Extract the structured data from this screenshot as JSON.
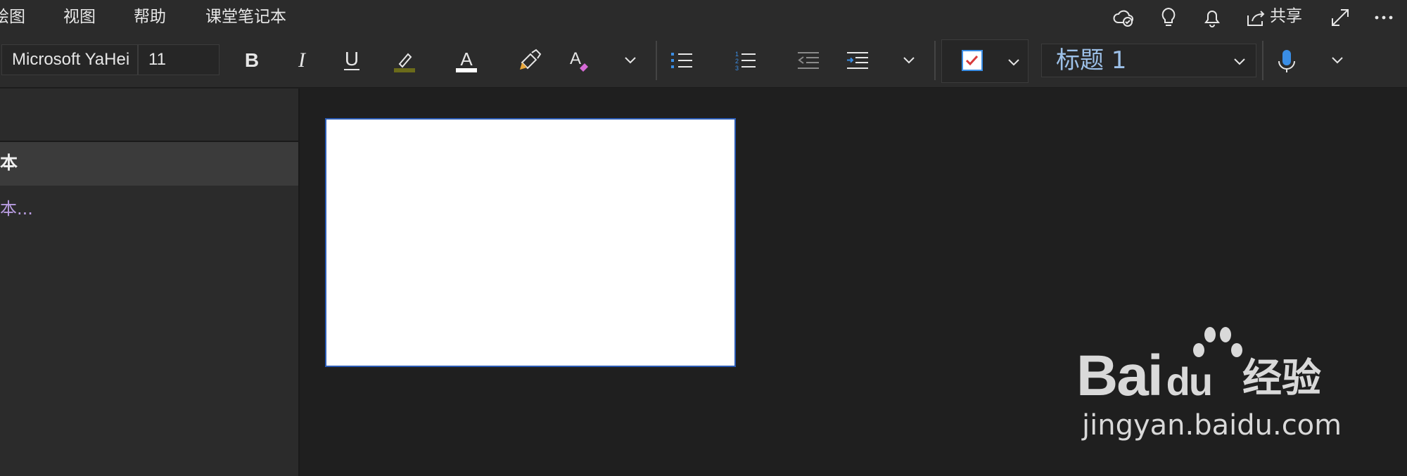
{
  "menu": {
    "items": [
      "绘图",
      "视图",
      "帮助",
      "课堂笔记本"
    ],
    "share_label": "共享"
  },
  "ribbon": {
    "font_name": "Microsoft YaHei",
    "font_size": "11",
    "style_value": "标题 1"
  },
  "page_list": {
    "selected_title": "本",
    "link_text": "本..."
  },
  "watermark": {
    "brand": "Bai",
    "brand2": "du",
    "jingyan": "经验",
    "url": "jingyan.baidu.com"
  },
  "colors": {
    "accent_blue": "#3a8ee6",
    "tag_check": "#d83b3b",
    "link_purple": "#b89ce0",
    "highlight": "#6b6b1a"
  }
}
